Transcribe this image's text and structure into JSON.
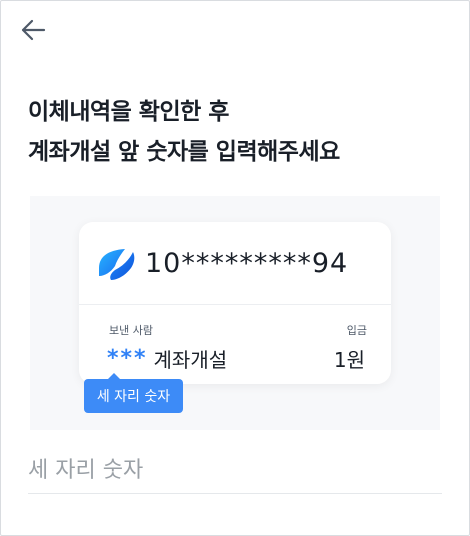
{
  "header": {
    "back_icon": "arrow-left-icon"
  },
  "title": {
    "line1": "이체내역을 확인한 후",
    "line2": "계좌개설 앞 숫자를 입력해주세요"
  },
  "card": {
    "bank_icon": "bank-logo-icon",
    "account_number": "10*********94",
    "sender_label": "보낸 사람",
    "deposit_label": "입금",
    "sender_code": "***",
    "sender_name": "계좌개설",
    "amount": "1원"
  },
  "tooltip": {
    "text": "세 자리 숫자"
  },
  "input": {
    "placeholder": "세 자리 숫자",
    "value": ""
  },
  "colors": {
    "accent": "#3182f6",
    "tooltip_bg": "#3d8bf7",
    "text": "#191f28"
  }
}
